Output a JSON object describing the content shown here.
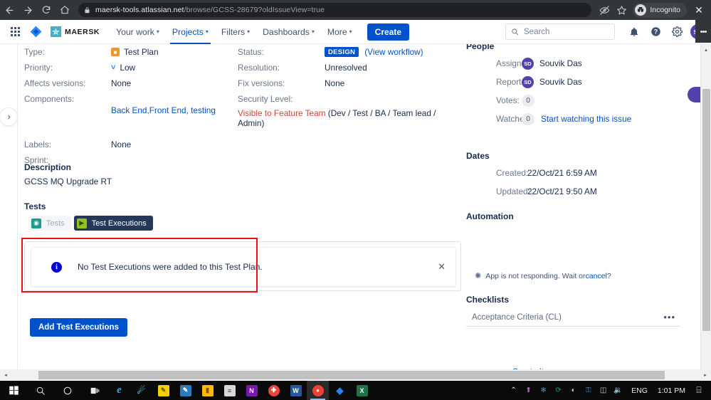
{
  "browser": {
    "back_icon": "back-arrow-icon",
    "forward_icon": "forward-arrow-icon",
    "reload_icon": "reload-icon",
    "home_icon": "home-icon",
    "lock_icon": "lock-icon",
    "url_host": "maersk-tools.atlassian.net",
    "url_path": "/browse/GCSS-28679?oldIssueView=true",
    "eye_icon": "eye-slash-icon",
    "star_icon": "star-icon",
    "incognito_label": "Incognito",
    "close_label": "✕"
  },
  "jira_nav": {
    "app_switcher_icon": "app-switcher-grid-icon",
    "jira_logo_icon": "jira-logo-icon",
    "brand_name": "MAERSK",
    "brand_star_icon": "maersk-star-icon",
    "items": [
      {
        "label": "Your work",
        "caret": "▾",
        "active": false
      },
      {
        "label": "Projects",
        "caret": "▾",
        "active": true
      },
      {
        "label": "Filters",
        "caret": "▾",
        "active": false
      },
      {
        "label": "Dashboards",
        "caret": "▾",
        "active": false
      },
      {
        "label": "More",
        "caret": "▾",
        "active": false
      }
    ],
    "create_label": "Create",
    "search_placeholder": "Search",
    "notifications_icon": "notification-bell-icon",
    "help_icon": "help-question-icon",
    "settings_icon": "gear-icon",
    "avatar_initials": "SD"
  },
  "fields": {
    "rows": [
      {
        "left": {
          "label": "Type:",
          "value": "Test Plan",
          "icon": "test-plan-icon"
        },
        "right": {
          "label": "Status:",
          "value": "DESIGN",
          "extra": "(View workflow)"
        }
      },
      {
        "left": {
          "label": "Priority:",
          "value": "Low",
          "icon": "priority-low-icon"
        },
        "right": {
          "label": "Resolution:",
          "value": "Unresolved"
        }
      },
      {
        "left": {
          "label": "Affects versions:",
          "value": "None"
        },
        "right": {
          "label": "Fix versions:",
          "value": "None"
        }
      },
      {
        "left": {
          "label": "Components:",
          "value": "Back End,Front End, testing",
          "is_link": true
        },
        "right": {
          "label": "Security Level:",
          "value": ""
        }
      },
      {
        "left": {
          "label": "Labels:",
          "value": "None"
        },
        "right": {
          "label": "",
          "value": ""
        }
      },
      {
        "left": {
          "label": "Sprint:",
          "value": ""
        },
        "right": {
          "label": "",
          "value": ""
        }
      }
    ],
    "security_level_red": "Visible to Feature Team",
    "security_level_rest": " (Dev / Test / BA / Team lead / Admin)"
  },
  "description": {
    "title": "Description",
    "text": "GCSS MQ Upgrade RT"
  },
  "tests": {
    "title": "Tests",
    "tabs": [
      {
        "label": "Tests",
        "icon": "xray-tests-icon",
        "glyph": "◉",
        "active": false
      },
      {
        "label": "Test Executions",
        "icon": "xray-executions-icon",
        "glyph": "▶",
        "active": true
      }
    ]
  },
  "banner": {
    "info_icon": "info-circle-icon",
    "message": "No Test Executions were added to this Test Plan.",
    "close_label": "✕",
    "highlight_color": "#ee1111"
  },
  "add_executions_button": "Add Test Executions",
  "right_panel": {
    "people": {
      "title": "People",
      "rows": [
        {
          "label": "Assignee:",
          "value": "Souvik Das",
          "avatar": "SD"
        },
        {
          "label": "Reporter:",
          "value": "Souvik Das",
          "avatar": "SD"
        },
        {
          "label": "Votes:",
          "value": "",
          "count": "0"
        },
        {
          "label": "Watchers:",
          "value": "Start watching this issue",
          "count": "0",
          "is_link": true
        }
      ]
    },
    "dates": {
      "title": "Dates",
      "rows": [
        {
          "label": "Created:",
          "value": "22/Oct/21 6:59 AM"
        },
        {
          "label": "Updated:",
          "value": "22/Oct/21 9:50 AM"
        }
      ]
    },
    "automation": {
      "title": "Automation"
    },
    "app_status": {
      "icon": "spinner-icon",
      "text": "App is not responding. Wait or ",
      "link": "cancel",
      "suffix": "?"
    },
    "checklists": {
      "title": "Checklists",
      "item": "Acceptance Criteria (CL)",
      "more_icon": "ellipsis-icon",
      "more_label": "•••",
      "create_item": "+ Create Item"
    }
  },
  "scrollbars": {
    "v_up": "▴",
    "v_down": "▾",
    "h_left": "◂",
    "h_right": "▸"
  },
  "taskbar": {
    "start_icon": "windows-start-icon",
    "search_icon": "taskbar-search-icon",
    "cortana_icon": "cortana-icon",
    "taskview_icon": "task-view-icon",
    "apps": [
      {
        "name": "internet-explorer",
        "glyph": "e",
        "bg": "transparent",
        "fg": "#2f9fd0",
        "running": false
      },
      {
        "name": "comet-browser",
        "glyph": "☄",
        "bg": "transparent",
        "fg": "#5fa8d3",
        "running": false
      },
      {
        "name": "sticky-notes",
        "glyph": "✎",
        "bg": "#f5d000",
        "fg": "#6b5900",
        "running": false
      },
      {
        "name": "paint",
        "glyph": "✏",
        "bg": "#2a7bbf",
        "fg": "#ffffff",
        "running": false
      },
      {
        "name": "file-explorer",
        "glyph": "▬",
        "bg": "#ffb901",
        "fg": "#7a5500",
        "running": false
      },
      {
        "name": "notepad-doc",
        "glyph": "≡",
        "bg": "#d8d8d8",
        "fg": "#444444",
        "running": false
      },
      {
        "name": "onenote",
        "glyph": "N",
        "bg": "#7719aa",
        "fg": "#ffffff",
        "running": false
      },
      {
        "name": "skype",
        "glyph": "✕",
        "bg": "#e8453c",
        "fg": "#ffffff",
        "running": false
      },
      {
        "name": "microsoft-word",
        "glyph": "W",
        "bg": "#2b579a",
        "fg": "#ffffff",
        "running": false
      },
      {
        "name": "google-chrome",
        "glyph": "●",
        "bg": "#ea4335",
        "fg": "#ffffff",
        "running": true
      },
      {
        "name": "jira-app",
        "glyph": "◆",
        "bg": "#0052cc",
        "fg": "#ffffff",
        "running": false
      },
      {
        "name": "microsoft-excel",
        "glyph": "X",
        "bg": "#217346",
        "fg": "#ffffff",
        "running": false
      }
    ],
    "tray": {
      "chevron": "⌃",
      "icons": [
        {
          "name": "onedrive-sync-icon",
          "glyph": "⬆",
          "color": "#b06ccf"
        },
        {
          "name": "network-share-icon",
          "glyph": "✴",
          "color": "#4aa3df"
        },
        {
          "name": "sync-arrows-icon",
          "glyph": "↻",
          "color": "#21a366"
        },
        {
          "name": "wifi-icon",
          "glyph": "◠",
          "color": "#d0d0d0"
        },
        {
          "name": "security-shield-icon",
          "glyph": "⛨",
          "color": "#3b8fd0"
        },
        {
          "name": "battery-icon",
          "glyph": "▃",
          "color": "#d0d0d0"
        },
        {
          "name": "volume-icon",
          "glyph": "◂",
          "color": "#d0d0d0"
        }
      ],
      "language": "ENG",
      "clock": "1:01 PM",
      "action_center_icon": "action-center-icon",
      "action_center_glyph": "⌸"
    }
  }
}
